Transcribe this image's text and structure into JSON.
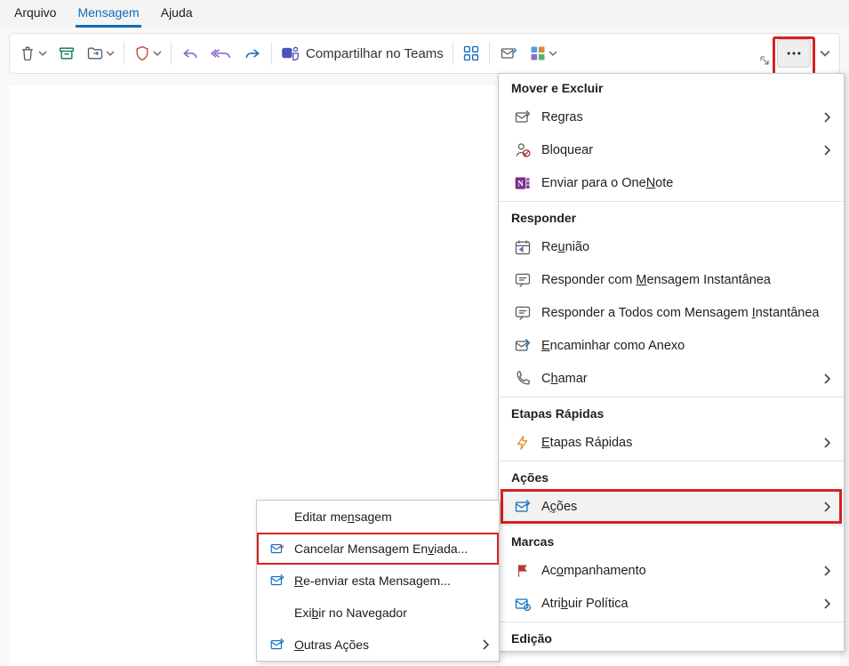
{
  "menubar": {
    "file": "Arquivo",
    "message": "Mensagem",
    "help": "Ajuda"
  },
  "toolbar": {
    "teams_share": "Compartilhar no Teams"
  },
  "submenu": {
    "edit": "Editar mensagem",
    "recall": "Cancelar Mensagem Enviada...",
    "resend": "Re-enviar esta Mensagem...",
    "browser": "Exibir no Navegador",
    "other": "Outras Ações"
  },
  "bigmenu": {
    "move_delete_header": "Mover e Excluir",
    "rules": "Regras",
    "block": "Bloquear",
    "onenote": "Enviar para o OneNote",
    "respond_header": "Responder",
    "meeting": "Reunião",
    "reply_im": "Responder com Mensagem Instantânea",
    "reply_all_im": "Responder a Todos com Mensagem Instantânea",
    "forward_attach": "Encaminhar como Anexo",
    "call": "Chamar",
    "quick_steps_header": "Etapas Rápidas",
    "quick_steps": "Etapas Rápidas",
    "actions_header": "Ações",
    "actions": "Ações",
    "tags_header": "Marcas",
    "followup": "Acompanhamento",
    "policy": "Atribuir Política",
    "edit_header": "Edição"
  }
}
